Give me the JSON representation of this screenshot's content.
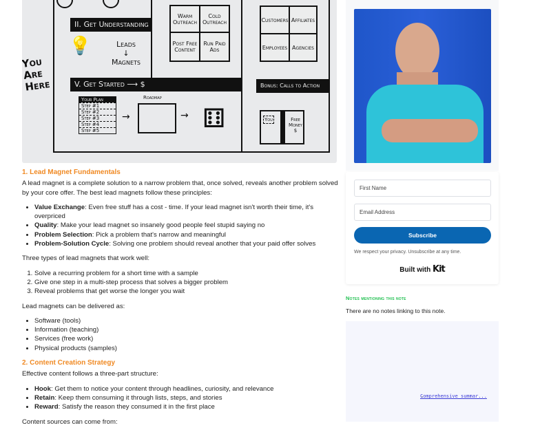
{
  "sketch": {
    "banner_understanding": "II. Get Understanding",
    "leads": "Leads",
    "arrow": "↓",
    "magnets": "Magnets",
    "you_are_here": "You Are Here",
    "banner_started": "V. Get Started ⟶ $",
    "banner_bonus": "Bonus: Calls to Action",
    "grid1": [
      "Warm Outreach",
      "Cold Outreach",
      "Post Free Content",
      "Run Paid Ads"
    ],
    "grid2": [
      "Customers",
      "Affiliates",
      "Employees",
      "Agencies"
    ],
    "your_plan": "Your Plan",
    "steps": [
      "Step #1",
      "Step #2",
      "Step #3",
      "Step #4",
      "Step #5"
    ],
    "roadmap": "Roadmap",
    "gift_you": "You",
    "gift_money": "Free Money $"
  },
  "article": {
    "s1_heading": "1. Lead Magnet Fundamentals",
    "s1_intro": "A lead magnet is a complete solution to a narrow problem that, once solved, reveals another problem solved by your core offer. The best lead magnets follow these principles:",
    "principles": [
      {
        "term": "Value Exchange",
        "text": ": Even free stuff has a cost - time. If your lead magnet isn't worth their time, it's overpriced"
      },
      {
        "term": "Quality",
        "text": ": Make your lead magnet so insanely good people feel stupid saying no"
      },
      {
        "term": "Problem Selection",
        "text": ": Pick a problem that's narrow and meaningful"
      },
      {
        "term": "Problem-Solution Cycle",
        "text": ": Solving one problem should reveal another that your paid offer solves"
      }
    ],
    "types_intro": "Three types of lead magnets that work well:",
    "types": [
      "Solve a recurring problem for a short time with a sample",
      "Give one step in a multi-step process that solves a bigger problem",
      "Reveal problems that get worse the longer you wait"
    ],
    "delivery_intro": "Lead magnets can be delivered as:",
    "delivery": [
      "Software (tools)",
      "Information (teaching)",
      "Services (free work)",
      "Physical products (samples)"
    ],
    "s2_heading": "2. Content Creation Strategy",
    "s2_intro": "Effective content follows a three-part structure:",
    "structure": [
      {
        "term": "Hook",
        "text": ": Get them to notice your content through headlines, curiosity, and relevance"
      },
      {
        "term": "Retain",
        "text": ": Keep them consuming it through lists, steps, and stories"
      },
      {
        "term": "Reward",
        "text": ": Satisfy the reason they consumed it in the first place"
      }
    ],
    "sources_intro": "Content sources can come from:"
  },
  "sidebar": {
    "form": {
      "first_name_placeholder": "First Name",
      "email_placeholder": "Email Address",
      "subscribe": "Subscribe",
      "privacy": "We respect your privacy. Unsubscribe at any time.",
      "built_with": "Built with",
      "kit": "Kit"
    },
    "notes_heading": "Notes mentioning this note",
    "notes_empty": "There are no notes linking to this note.",
    "graph_link": "Comprehensive summar..."
  },
  "colors": {
    "heading": "#f08a24",
    "button": "#0a66b2",
    "notes_heading": "#1fbf4f"
  }
}
